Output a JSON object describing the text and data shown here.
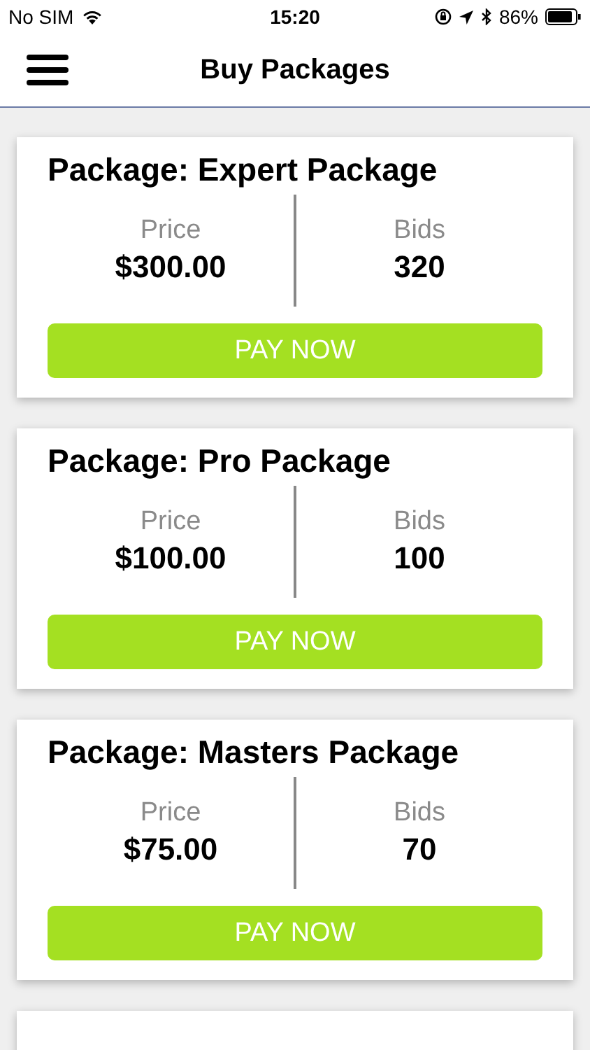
{
  "status_bar": {
    "carrier": "No SIM",
    "time": "15:20",
    "battery": "86%"
  },
  "header": {
    "title": "Buy Packages"
  },
  "packages": [
    {
      "title": "Package: Expert Package",
      "price_label": "Price",
      "price": "$300.00",
      "bids_label": "Bids",
      "bids": "320",
      "button": "PAY NOW"
    },
    {
      "title": "Package: Pro Package",
      "price_label": "Price",
      "price": "$100.00",
      "bids_label": "Bids",
      "bids": "100",
      "button": "PAY NOW"
    },
    {
      "title": "Package: Masters Package",
      "price_label": "Price",
      "price": "$75.00",
      "bids_label": "Bids",
      "bids": "70",
      "button": "PAY NOW"
    }
  ]
}
